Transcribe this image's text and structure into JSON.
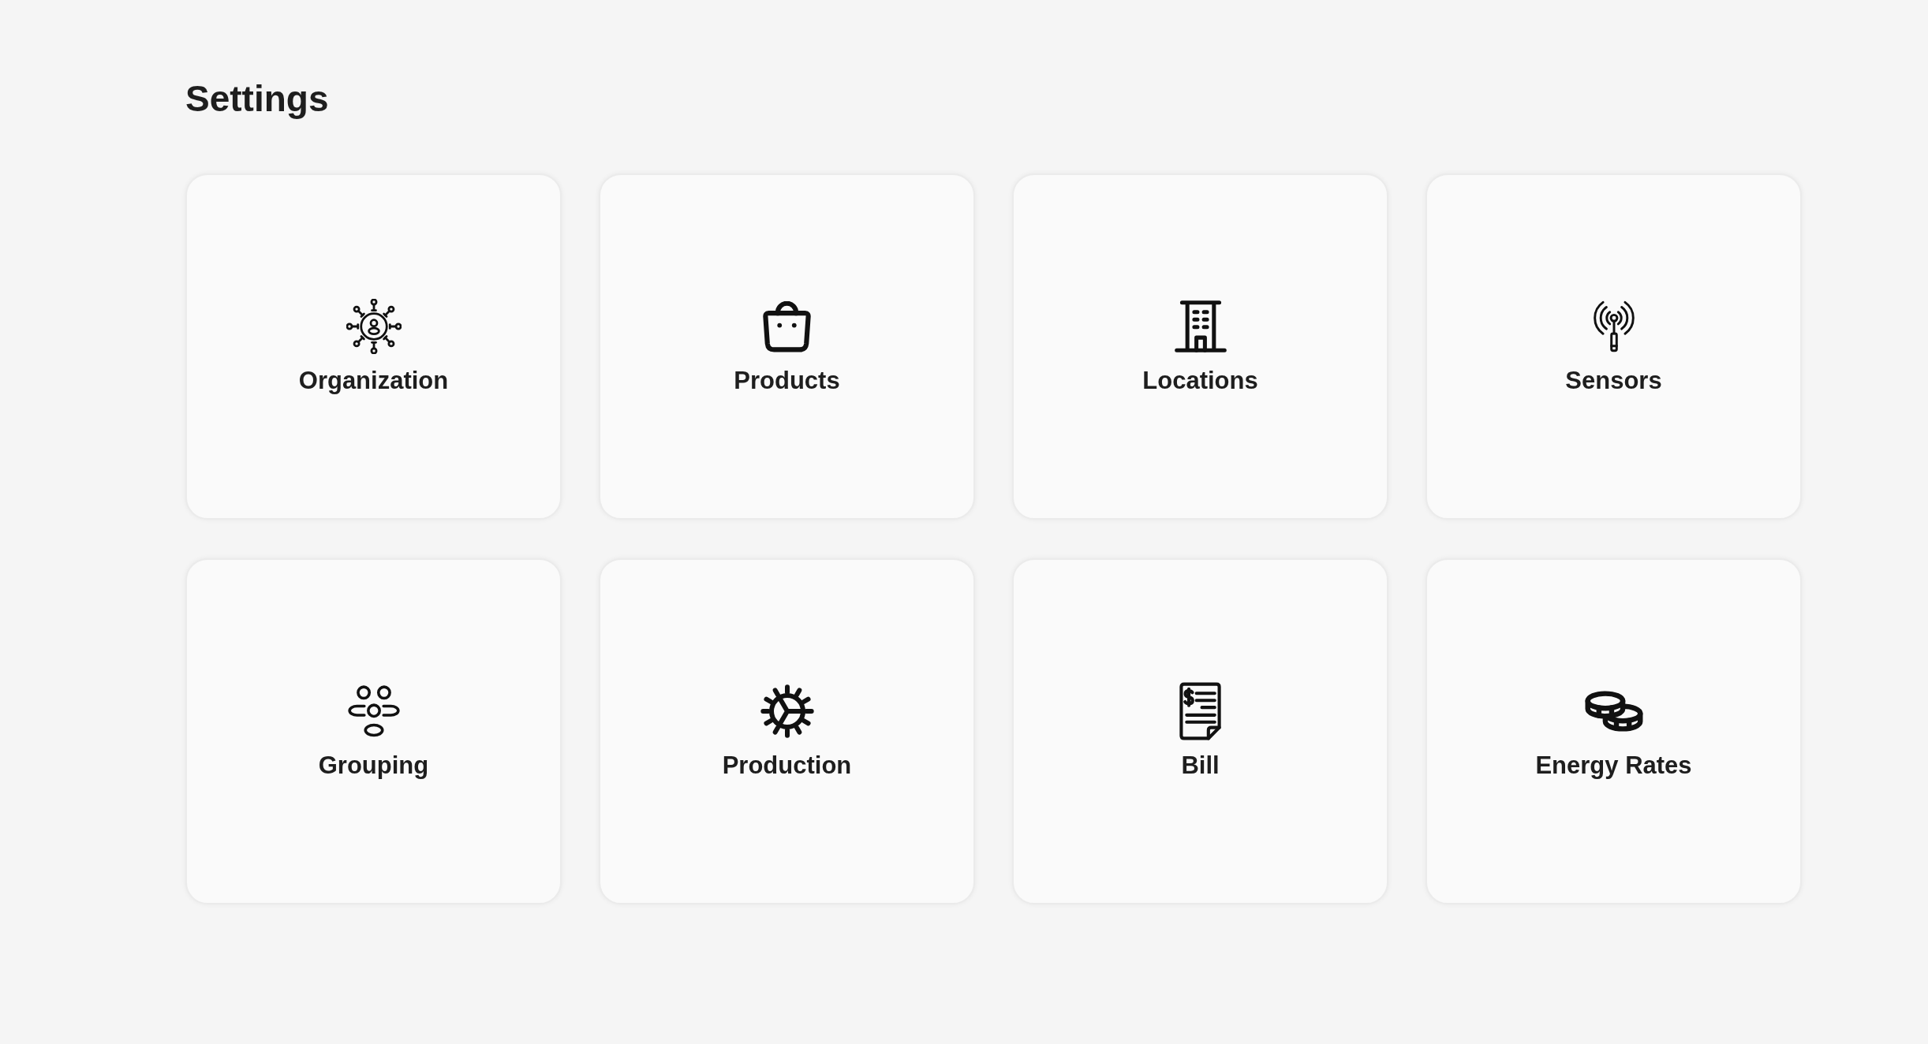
{
  "page": {
    "title": "Settings"
  },
  "cards": [
    {
      "label": "Organization"
    },
    {
      "label": "Products"
    },
    {
      "label": "Locations"
    },
    {
      "label": "Sensors"
    },
    {
      "label": "Grouping"
    },
    {
      "label": "Production"
    },
    {
      "label": "Bill"
    },
    {
      "label": "Energy Rates"
    }
  ]
}
